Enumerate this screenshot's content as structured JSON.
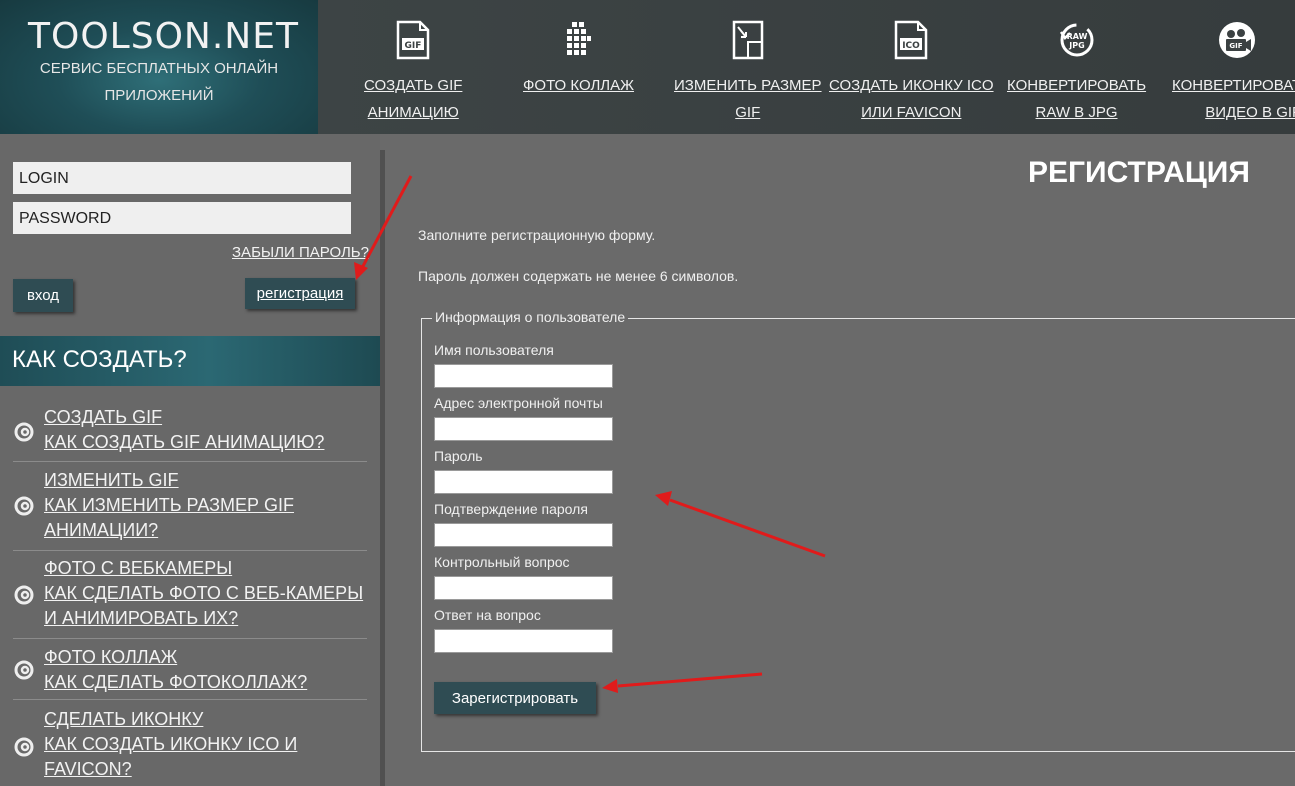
{
  "logo": {
    "title": "TOOLSON.NET",
    "subtitle_line1": "СЕРВИС БЕСПЛАТНЫХ ОНЛАЙН",
    "subtitle_line2": "ПРИЛОЖЕНИЙ"
  },
  "nav": [
    {
      "line1": "СОЗДАТЬ GIF",
      "line2": "АНИМАЦИЮ",
      "icon": "gif-file-icon"
    },
    {
      "line1": "ФОТО КОЛЛАЖ",
      "line2": "",
      "icon": "collage-grid-icon"
    },
    {
      "line1": "ИЗМЕНИТЬ РАЗМЕР",
      "line2": "GIF",
      "icon": "resize-icon"
    },
    {
      "line1": "СОЗДАТЬ ИКОНКУ ICO",
      "line2": "ИЛИ FAVICON",
      "icon": "ico-file-icon"
    },
    {
      "line1": "КОНВЕРТИРОВАТЬ",
      "line2": "RAW В JPG",
      "icon": "raw-to-jpg-icon"
    },
    {
      "line1": "КОНВЕРТИРОВАТ",
      "line2": "ВИДЕО В GIF",
      "icon": "video-to-gif-icon"
    }
  ],
  "login": {
    "login_placeholder": "LOGIN",
    "password_placeholder": "PASSWORD",
    "forgot": "ЗАБЫЛИ ПАРОЛЬ?",
    "enter_button": "вход",
    "register_button": "регистрация"
  },
  "howto": {
    "title": "КАК СОЗДАТЬ?",
    "items": [
      {
        "lines": [
          "СОЗДАТЬ GIF",
          "КАК СОЗДАТЬ GIF АНИМАЦИЮ?"
        ]
      },
      {
        "lines": [
          "ИЗМЕНИТЬ GIF",
          "КАК ИЗМЕНИТЬ РАЗМЕР GIF",
          "АНИМАЦИИ?"
        ]
      },
      {
        "lines": [
          "ФОТО С ВЕБКАМЕРЫ",
          "КАК СДЕЛАТЬ ФОТО С ВЕБ-КАМЕРЫ",
          "И АНИМИРОВАТЬ ИХ?"
        ]
      },
      {
        "lines": [
          "ФОТО КОЛЛАЖ",
          "КАК СДЕЛАТЬ ФОТОКОЛЛАЖ?"
        ]
      },
      {
        "lines": [
          "СДЕЛАТЬ ИКОНКУ",
          "КАК СОЗДАТЬ ИКОНКУ ICO И",
          "FAVICON?"
        ]
      }
    ]
  },
  "main": {
    "title": "РЕГИСТРАЦИЯ",
    "intro1": "Заполните регистрационную форму.",
    "intro2": "Пароль должен содержать не менее 6 символов.",
    "legend": "Информация о пользователе",
    "fields": [
      {
        "label": "Имя пользователя",
        "value": ""
      },
      {
        "label": "Адрес электронной почты",
        "value": ""
      },
      {
        "label": "Пароль",
        "value": ""
      },
      {
        "label": "Подтверждение пароля",
        "value": ""
      },
      {
        "label": "Контрольный вопрос",
        "value": ""
      },
      {
        "label": "Ответ на вопрос",
        "value": ""
      }
    ],
    "submit": "Зарегистрировать"
  },
  "colors": {
    "accent_dark": "#2f4c53",
    "annotation_arrow": "#e01b1b"
  }
}
